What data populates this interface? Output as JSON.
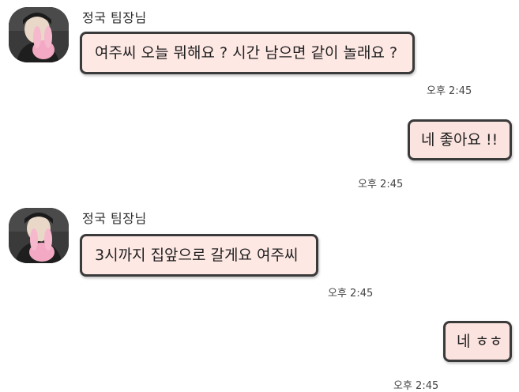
{
  "chat": {
    "sender_name": "정국 팀장님",
    "messages": [
      {
        "from": "other",
        "text": "여주씨 오늘 뭐해요 ? 시간 남으면 같이 놀래요 ?",
        "time": "오후 2:45"
      },
      {
        "from": "me",
        "text": "네 좋아요 !!",
        "time": "오후 2:45"
      },
      {
        "from": "other",
        "text": "3시까지 집앞으로 갈게요 여주씨",
        "time": "오후 2:45"
      },
      {
        "from": "me",
        "text": "네 ㅎㅎ",
        "time": "오후 2:45"
      }
    ]
  },
  "colors": {
    "bubble_fill": "#fde8e4",
    "bubble_border": "#3a3a3a",
    "avatar_plush": "#f3a9c3"
  }
}
